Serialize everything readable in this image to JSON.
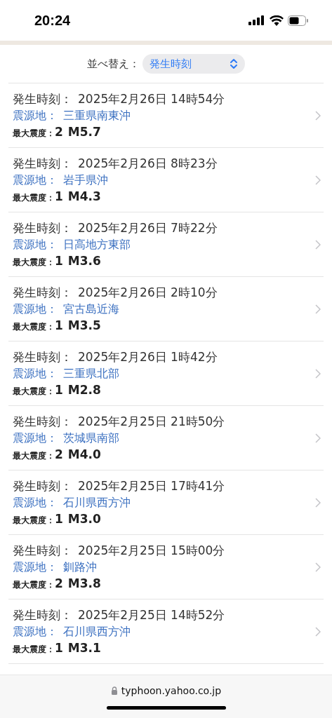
{
  "status_bar": {
    "time": "20:24"
  },
  "sort": {
    "label": "並べ替え：",
    "value": "発生時刻"
  },
  "quakes": [
    {
      "time_label": "発生時刻：",
      "time": "2025年2月26日 14時54分",
      "epicenter_label": "震源地：",
      "epicenter": "三重県南東沖",
      "intensity_label": "最大震度：",
      "intensity": "2",
      "magnitude": "M5.7"
    },
    {
      "time_label": "発生時刻：",
      "time": "2025年2月26日 8時23分",
      "epicenter_label": "震源地：",
      "epicenter": "岩手県沖",
      "intensity_label": "最大震度：",
      "intensity": "1",
      "magnitude": "M4.3"
    },
    {
      "time_label": "発生時刻：",
      "time": "2025年2月26日 7時22分",
      "epicenter_label": "震源地：",
      "epicenter": "日高地方東部",
      "intensity_label": "最大震度：",
      "intensity": "1",
      "magnitude": "M3.6"
    },
    {
      "time_label": "発生時刻：",
      "time": "2025年2月26日 2時10分",
      "epicenter_label": "震源地：",
      "epicenter": "宮古島近海",
      "intensity_label": "最大震度：",
      "intensity": "1",
      "magnitude": "M3.5"
    },
    {
      "time_label": "発生時刻：",
      "time": "2025年2月26日 1時42分",
      "epicenter_label": "震源地：",
      "epicenter": "三重県北部",
      "intensity_label": "最大震度：",
      "intensity": "1",
      "magnitude": "M2.8"
    },
    {
      "time_label": "発生時刻：",
      "time": "2025年2月25日 21時50分",
      "epicenter_label": "震源地：",
      "epicenter": "茨城県南部",
      "intensity_label": "最大震度：",
      "intensity": "2",
      "magnitude": "M4.0"
    },
    {
      "time_label": "発生時刻：",
      "time": "2025年2月25日 17時41分",
      "epicenter_label": "震源地：",
      "epicenter": "石川県西方沖",
      "intensity_label": "最大震度：",
      "intensity": "1",
      "magnitude": "M3.0"
    },
    {
      "time_label": "発生時刻：",
      "time": "2025年2月25日 15時00分",
      "epicenter_label": "震源地：",
      "epicenter": "釧路沖",
      "intensity_label": "最大震度：",
      "intensity": "2",
      "magnitude": "M3.8"
    },
    {
      "time_label": "発生時刻：",
      "time": "2025年2月25日 14時52分",
      "epicenter_label": "震源地：",
      "epicenter": "石川県西方沖",
      "intensity_label": "最大震度：",
      "intensity": "1",
      "magnitude": "M3.1"
    }
  ],
  "address_bar": {
    "url": "typhoon.yahoo.co.jp"
  }
}
